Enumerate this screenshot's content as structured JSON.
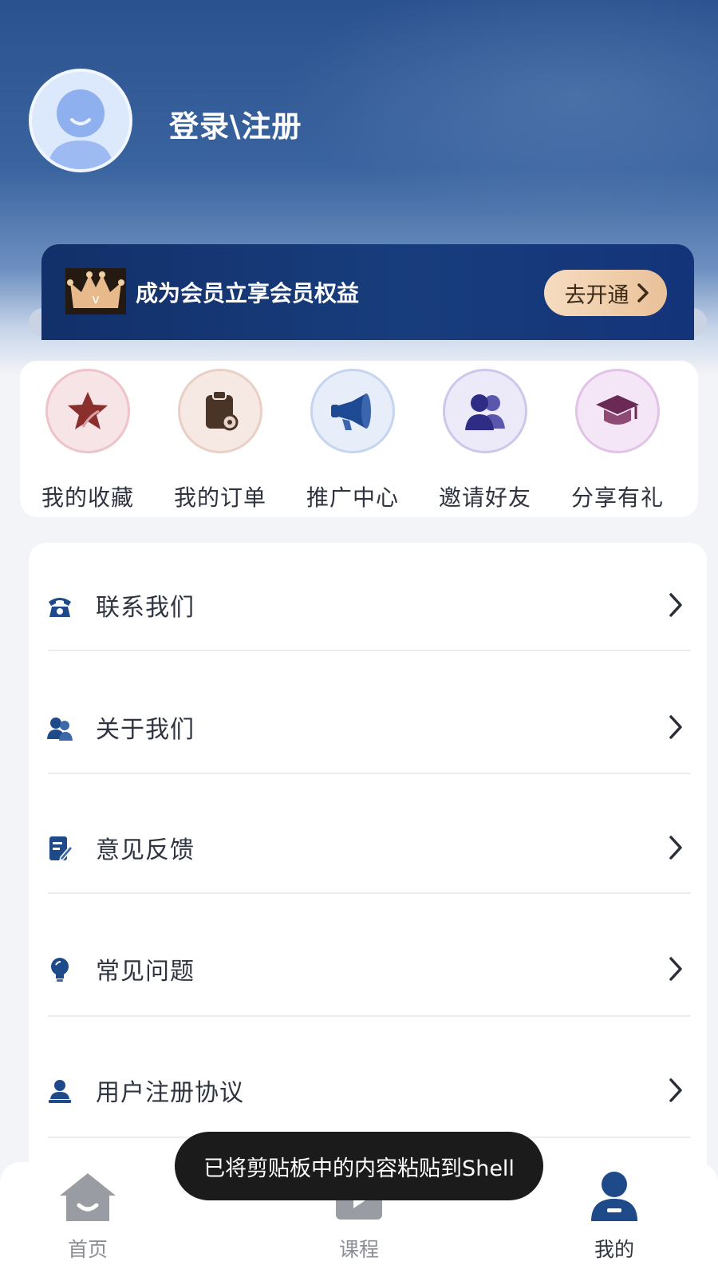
{
  "profile": {
    "login_label": "登录\\注册"
  },
  "vip": {
    "text": "成为会员立享会员权益",
    "button_label": "去开通"
  },
  "quick_actions": [
    {
      "label": "我的收藏",
      "icon": "star-icon"
    },
    {
      "label": "我的订单",
      "icon": "clipboard-icon"
    },
    {
      "label": "推广中心",
      "icon": "megaphone-icon"
    },
    {
      "label": "邀请好友",
      "icon": "users-icon"
    },
    {
      "label": "分享有礼",
      "icon": "graduation-cap-icon"
    }
  ],
  "menu": [
    {
      "label": "联系我们",
      "icon": "phone-icon"
    },
    {
      "label": "关于我们",
      "icon": "team-icon"
    },
    {
      "label": "意见反馈",
      "icon": "feedback-icon"
    },
    {
      "label": "常见问题",
      "icon": "lightbulb-icon"
    },
    {
      "label": "用户注册协议",
      "icon": "user-agreement-icon"
    }
  ],
  "tabbar": [
    {
      "label": "首页",
      "icon": "home-icon"
    },
    {
      "label": "课程",
      "icon": "play-icon"
    },
    {
      "label": "我的",
      "icon": "profile-icon"
    }
  ],
  "toast": {
    "text": "已将剪贴板中的内容粘贴到Shell"
  },
  "colors": {
    "header_blue": "#2a528e",
    "vip_card": "#183d7c",
    "vip_button": "#f0d2b0",
    "icon_blue": "#1f4a8a"
  }
}
